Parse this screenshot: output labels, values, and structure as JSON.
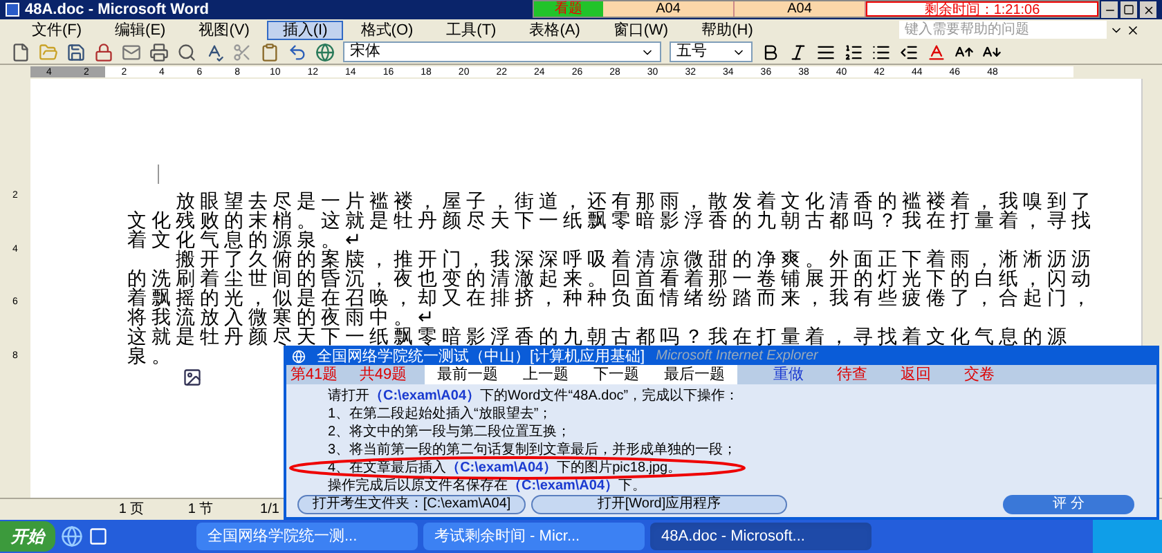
{
  "window": {
    "title": "48A.doc - Microsoft Word"
  },
  "timer": {
    "status": "看题",
    "cells": [
      "A04",
      "A04"
    ],
    "remaining": "剩余时间：1:21:06"
  },
  "menu": [
    {
      "label": "文件(F)",
      "selected": false
    },
    {
      "label": "编辑(E)",
      "selected": false
    },
    {
      "label": "视图(V)",
      "selected": false
    },
    {
      "label": "插入(I)",
      "selected": true
    },
    {
      "label": "格式(O)",
      "selected": false
    },
    {
      "label": "工具(T)",
      "selected": false
    },
    {
      "label": "表格(A)",
      "selected": false
    },
    {
      "label": "窗口(W)",
      "selected": false
    },
    {
      "label": "帮助(H)",
      "selected": false
    }
  ],
  "help_search": {
    "placeholder": "键入需要帮助的问题"
  },
  "toolbar": {
    "font": "宋体",
    "size": "五号"
  },
  "ruler": {
    "left_ticks": [
      "4",
      "2"
    ],
    "ticks": [
      "2",
      "4",
      "6",
      "8",
      "10",
      "12",
      "14",
      "16",
      "18",
      "20",
      "22",
      "24",
      "26",
      "28",
      "30",
      "32",
      "34",
      "36",
      "38",
      "40",
      "42",
      "44",
      "46",
      "48"
    ]
  },
  "vruler_ticks": [
    "2",
    "4",
    "6",
    "8"
  ],
  "document": {
    "paragraphs": [
      {
        "text": "放眼望去尽是一片褴褛，屋子，街道，还有那雨，散发着文化清香的褴褛着，我嗅到了文化残败的末梢。这就是牡丹颜尽天下一纸飘零暗影浮香的九朝古都吗？我在打量着，寻找着文化气息的源泉。↵",
        "indent": true
      },
      {
        "text": "搬开了久俯的案牍，推开门，我深深呼吸着清凉微甜的净爽。外面正下着雨，淅淅沥沥的洗刷着尘世间的昏沉，夜也变的清澈起来。回首看着那一卷铺展开的灯光下的白纸，闪动着飘摇的光，似是在召唤，却又在排挤，种种负面情绪纷踏而来，我有些疲倦了，合起门，将我流放入微寒的夜雨中。↵",
        "indent": true
      },
      {
        "lines": [
          "这就是牡丹颜尽天下一纸飘零暗影浮香的九朝古都吗？我在打量着，寻找着文化气息的源",
          "泉。"
        ],
        "indent": false
      }
    ]
  },
  "status_bar": [
    "1 页",
    "1 节",
    "1/1"
  ],
  "dialog": {
    "title": "全国网络学院统一测试（中山）[计算机应用基础]",
    "title_suffix": "Microsoft Internet Explorer",
    "question_no": "第41题",
    "question_total": "共49题",
    "nav": [
      "最前一题",
      "上一题",
      "下一题",
      "最后一题"
    ],
    "actions": [
      "重做",
      "待查",
      "返回",
      "交卷"
    ],
    "lines": [
      {
        "parts": [
          {
            "kind": "plain",
            "text": "请打开"
          },
          {
            "kind": "path",
            "text": "（C:\\exam\\A04）"
          },
          {
            "kind": "plain",
            "text": "下的Word文件“48A.doc”，完成以下操作："
          }
        ],
        "circled": false
      },
      {
        "parts": [
          {
            "kind": "plain",
            "text": "1、在第二段起始处插入“放眼望去”；"
          }
        ],
        "circled": false
      },
      {
        "parts": [
          {
            "kind": "plain",
            "text": "2、将文中的第一段与第二段位置互换；"
          }
        ],
        "circled": false
      },
      {
        "parts": [
          {
            "kind": "plain",
            "text": "3、将当前第一段的第二句话复制到文章最后，并形成单独的一段；"
          }
        ],
        "circled": false
      },
      {
        "parts": [
          {
            "kind": "plain",
            "text": "4、在文章最后插入"
          },
          {
            "kind": "path",
            "text": "（C:\\exam\\A04）"
          },
          {
            "kind": "plain",
            "text": "下的图片pic18.jpg。"
          }
        ],
        "circled": true
      },
      {
        "parts": [
          {
            "kind": "plain",
            "text": "操作完成后以原文件名保存在"
          },
          {
            "kind": "path",
            "text": "（C:\\exam\\A04）"
          },
          {
            "kind": "plain",
            "text": "下。"
          }
        ],
        "circled": false
      }
    ],
    "buttons": [
      "打开考生文件夹：[C:\\exam\\A04]",
      "打开[Word]应用程序"
    ],
    "grade": "评 分"
  },
  "taskbar": {
    "start": "开始",
    "tasks": [
      {
        "label": "全国网络学院统一测...",
        "selected": false
      },
      {
        "label": "考试剩余时间 - Micr...",
        "selected": false
      },
      {
        "label": "48A.doc - Microsoft...",
        "selected": true
      }
    ]
  }
}
